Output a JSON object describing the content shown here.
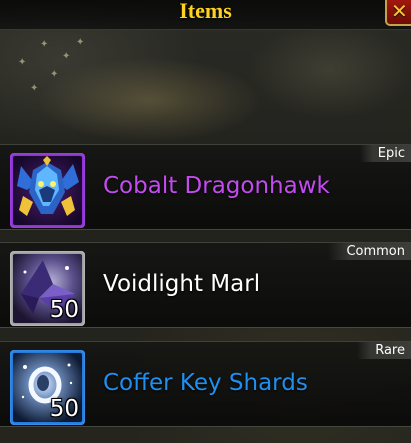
{
  "window": {
    "title": "Items",
    "close_label": "✕"
  },
  "items": [
    {
      "name": "Cobalt Dragonhawk",
      "rarity": "Epic",
      "count": "",
      "icon": "dragonhawk-mount-icon",
      "color": "#c34cf0"
    },
    {
      "name": "Voidlight Marl",
      "rarity": "Common",
      "count": "50",
      "icon": "void-crystal-icon",
      "color": "#ffffff"
    },
    {
      "name": "Coffer Key Shards",
      "rarity": "Rare",
      "count": "50",
      "icon": "key-shard-orb-icon",
      "color": "#1f8ff0"
    }
  ],
  "colors": {
    "epic": "#c34cf0",
    "common": "#ffffff",
    "rare": "#1f8ff0",
    "title": "#ffd21f"
  }
}
